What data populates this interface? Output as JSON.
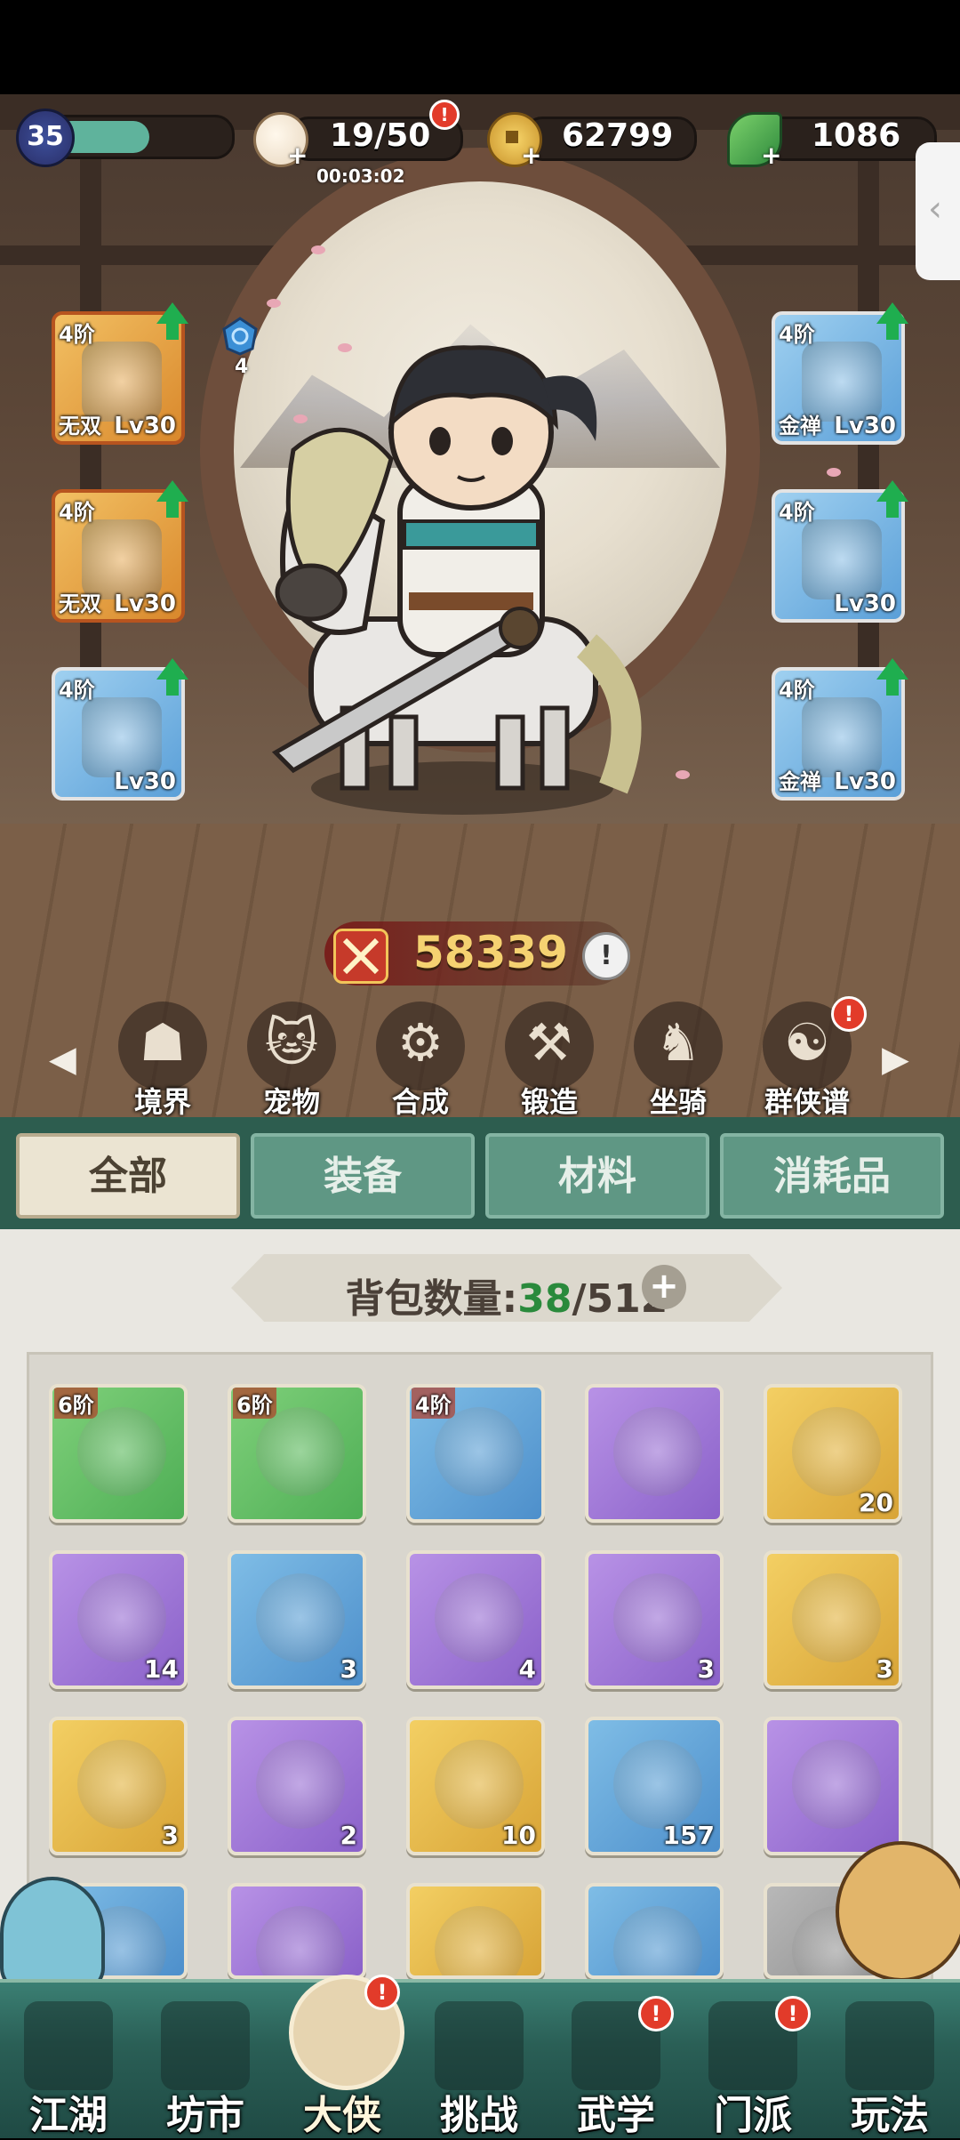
{
  "hud": {
    "level": "35",
    "stamina": "19/50",
    "stamina_timer": "00:03:02",
    "coins": "62799",
    "jade": "1086"
  },
  "equipment_left": [
    {
      "tier": "4阶",
      "name": "无双",
      "level": "Lv30",
      "icon": "sword-icon",
      "frame": "#e6a33d"
    },
    {
      "tier": "4阶",
      "name": "无双",
      "level": "Lv30",
      "icon": "robe-icon",
      "frame": "#e6a33d"
    },
    {
      "tier": "4阶",
      "name": "",
      "level": "Lv30",
      "icon": "pants-icon",
      "frame": "#5fa8e0"
    }
  ],
  "equipment_right": [
    {
      "tier": "4阶",
      "name": "金禅",
      "level": "Lv30",
      "icon": "ring-icon",
      "frame": "#5fa8e0"
    },
    {
      "tier": "4阶",
      "name": "",
      "level": "Lv30",
      "icon": "jade-pendant-icon",
      "frame": "#5fa8e0"
    },
    {
      "tier": "4阶",
      "name": "金禅",
      "level": "Lv30",
      "icon": "boots-icon",
      "frame": "#5fa8e0"
    }
  ],
  "gem": {
    "count": "4"
  },
  "power": "58339",
  "menu": [
    {
      "label": "境界",
      "glyph": "☗"
    },
    {
      "label": "宠物",
      "glyph": "🐱"
    },
    {
      "label": "合成",
      "glyph": "⚙"
    },
    {
      "label": "锻造",
      "glyph": "⚒"
    },
    {
      "label": "坐骑",
      "glyph": "♞"
    },
    {
      "label": "群侠谱",
      "glyph": "☯"
    }
  ],
  "tabs": [
    "全部",
    "装备",
    "材料",
    "消耗品"
  ],
  "bag": {
    "label": "背包数量:",
    "used": "38",
    "total": "/512"
  },
  "items": [
    {
      "tier": "6阶",
      "count": "",
      "color": "green",
      "icon": "sword-icon"
    },
    {
      "tier": "6阶",
      "count": "",
      "color": "green",
      "icon": "ring-icon"
    },
    {
      "tier": "4阶",
      "count": "",
      "color": "blue",
      "icon": "fan-icon"
    },
    {
      "tier": "",
      "count": "",
      "color": "purple",
      "icon": "wine-jar-icon"
    },
    {
      "tier": "",
      "count": "20",
      "color": "gold",
      "icon": "key-icon"
    },
    {
      "tier": "",
      "count": "14",
      "color": "purple",
      "icon": "scroll-icon"
    },
    {
      "tier": "",
      "count": "3",
      "color": "blue",
      "icon": "fruit-icon"
    },
    {
      "tier": "",
      "count": "4",
      "color": "purple",
      "icon": "card-icon"
    },
    {
      "tier": "",
      "count": "3",
      "color": "purple",
      "icon": "pouch-icon"
    },
    {
      "tier": "",
      "count": "3",
      "color": "gold",
      "icon": "teapot-icon"
    },
    {
      "tier": "",
      "count": "3",
      "color": "gold",
      "icon": "book-icon"
    },
    {
      "tier": "",
      "count": "2",
      "color": "purple",
      "icon": "ticket-icon"
    },
    {
      "tier": "",
      "count": "10",
      "color": "gold",
      "icon": "ticket-icon"
    },
    {
      "tier": "",
      "count": "157",
      "color": "blue",
      "icon": "berries-icon"
    },
    {
      "tier": "",
      "count": "",
      "color": "purple",
      "icon": "persimmon-icon"
    },
    {
      "tier": "",
      "count": "",
      "color": "blue",
      "icon": "item-icon"
    },
    {
      "tier": "",
      "count": "",
      "color": "purple",
      "icon": "branch-icon"
    },
    {
      "tier": "",
      "count": "",
      "color": "gold",
      "icon": "firecracker-icon"
    },
    {
      "tier": "",
      "count": "",
      "color": "blue",
      "icon": "crystal-icon"
    },
    {
      "tier": "",
      "count": "",
      "color": "gray",
      "icon": "item-icon"
    }
  ],
  "bottom_nav": [
    {
      "label": "江湖",
      "badge": false,
      "active": false
    },
    {
      "label": "坊市",
      "badge": false,
      "active": false
    },
    {
      "label": "大侠",
      "badge": true,
      "active": true
    },
    {
      "label": "挑战",
      "badge": false,
      "active": false
    },
    {
      "label": "武学",
      "badge": true,
      "active": false
    },
    {
      "label": "门派",
      "badge": true,
      "active": false
    },
    {
      "label": "玩法",
      "badge": false,
      "active": false
    }
  ],
  "colors": {
    "stamina_bar": "#5fb39c",
    "tab_active_bg": "#ebe4d2",
    "tab_inactive_bg": "#5f9784",
    "bag_used": "#2a8a3c",
    "power_text": "#f5d271"
  }
}
